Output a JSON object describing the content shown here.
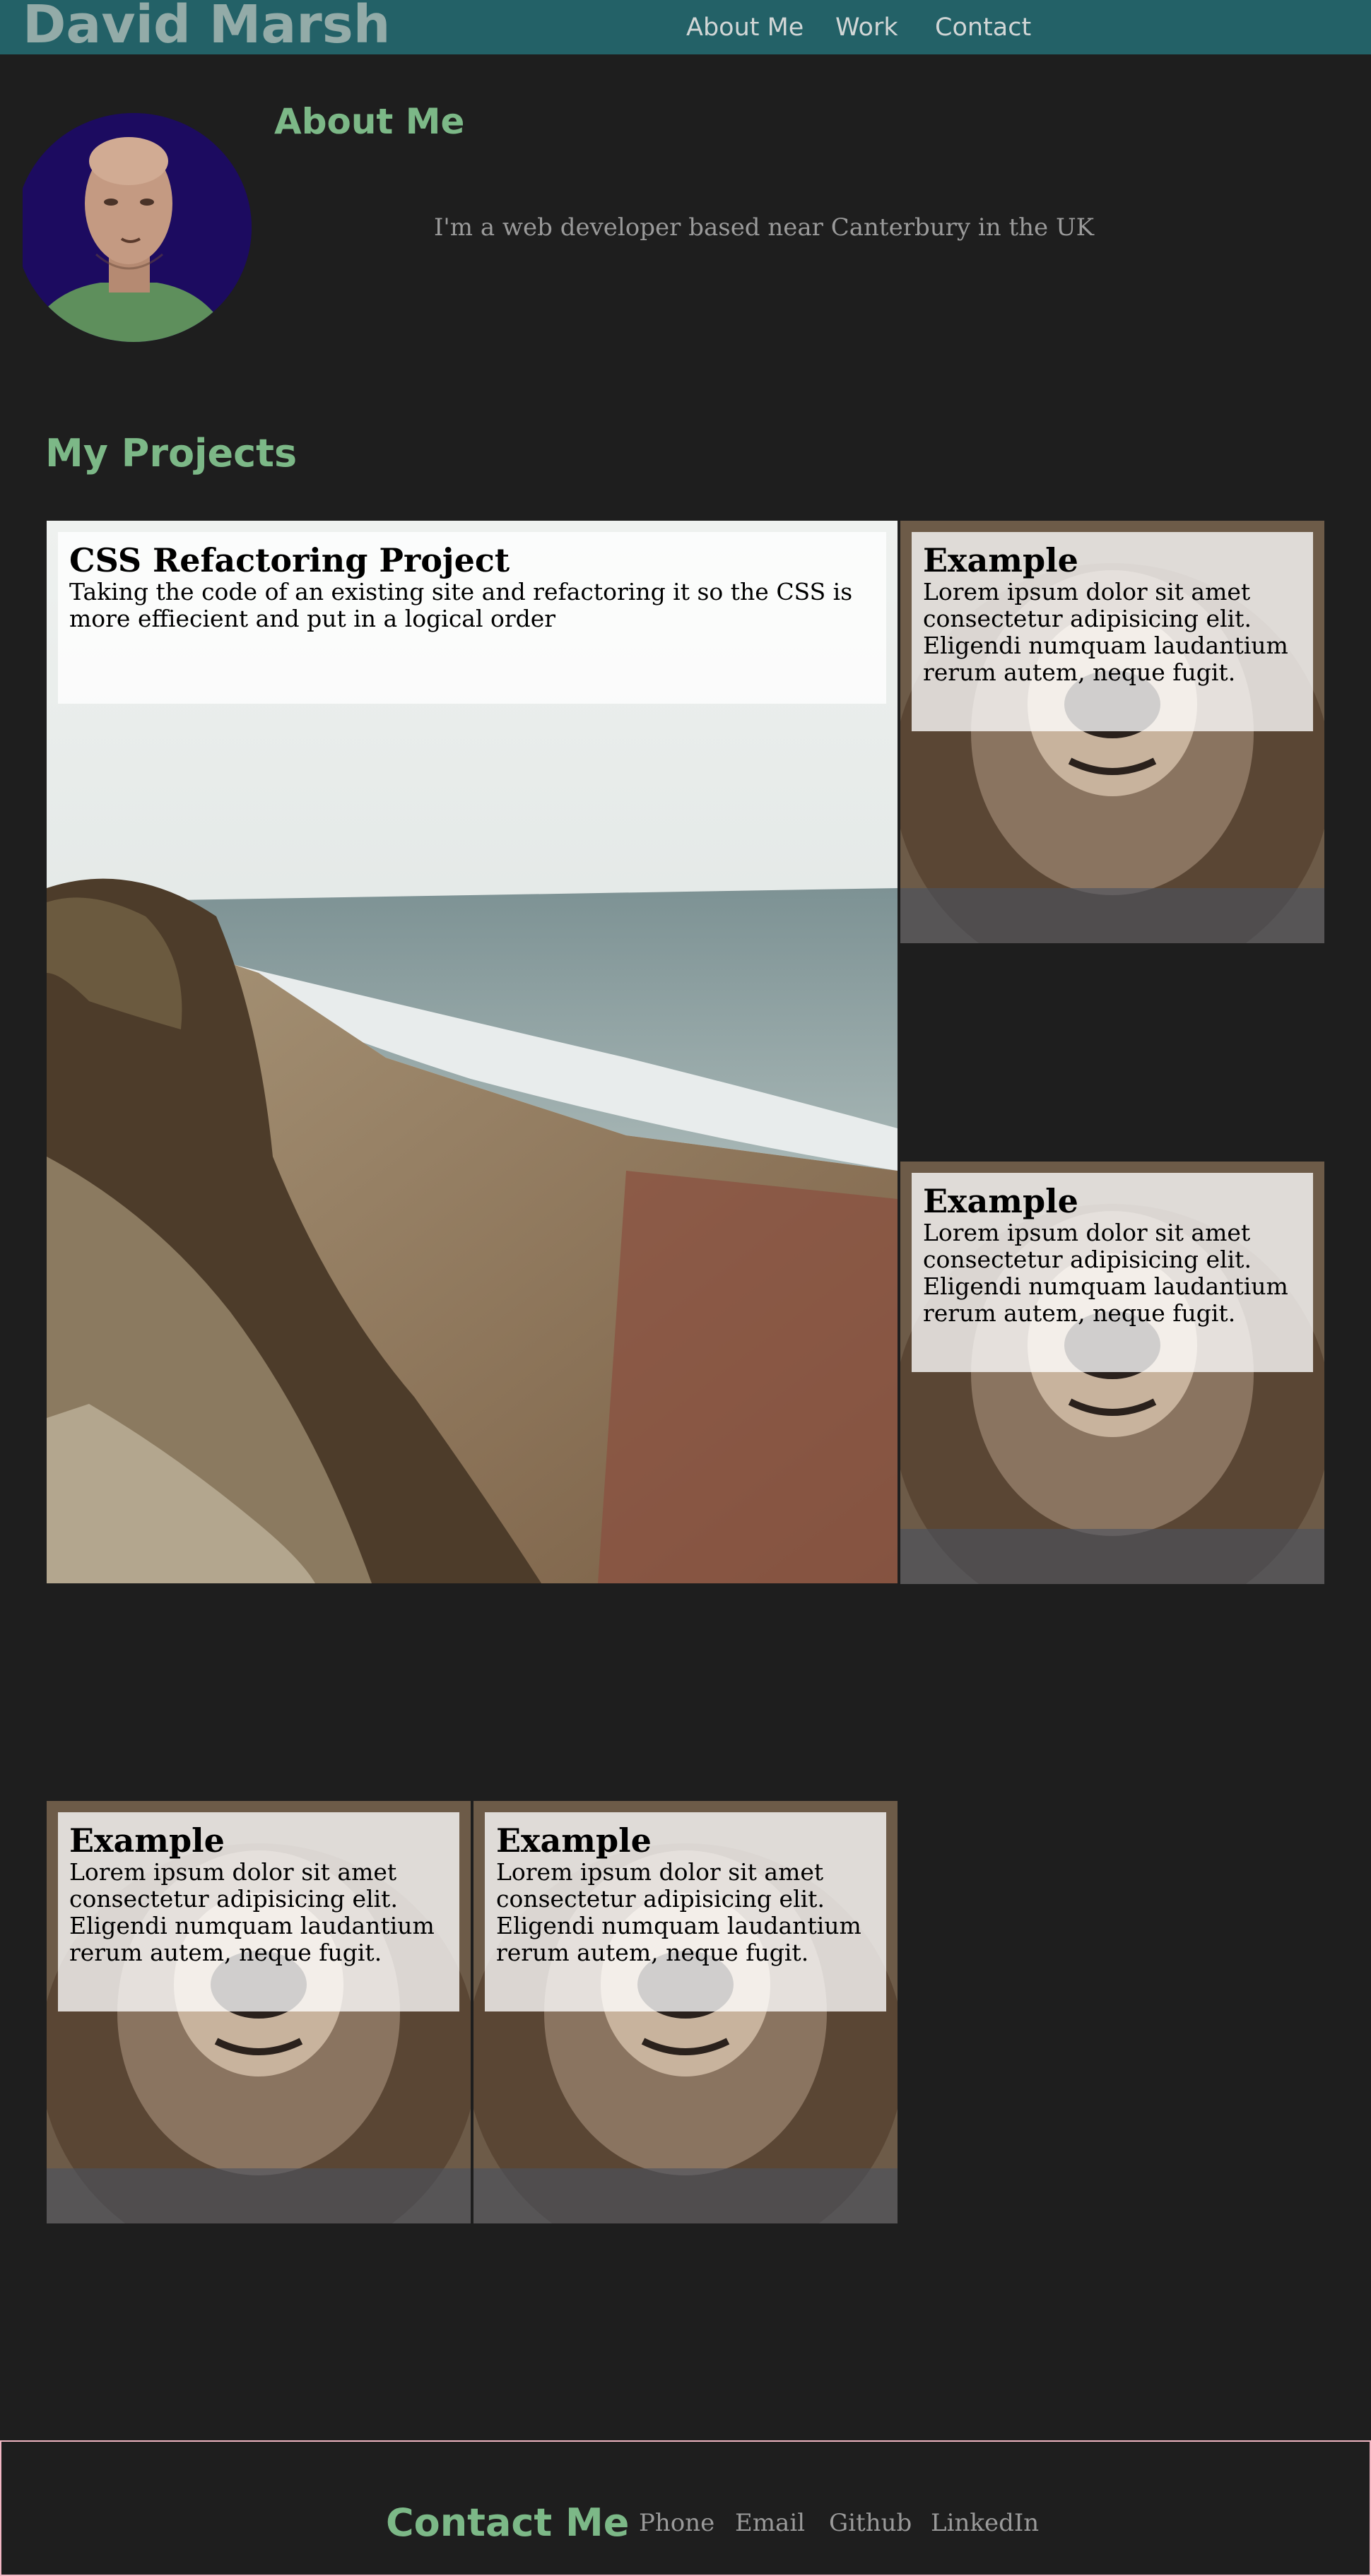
{
  "header": {
    "brand": "David Marsh",
    "nav": [
      {
        "label": "About Me"
      },
      {
        "label": "Work"
      },
      {
        "label": "Contact"
      }
    ]
  },
  "about": {
    "title": "About Me",
    "text": "I'm a web developer based near Canterbury in the UK"
  },
  "projects": {
    "title": "My Projects",
    "items": [
      {
        "title": "CSS Refactoring Project",
        "description": "Taking the code of an existing site and refactoring it so the CSS is more effiecient and put in a logical order",
        "image": "coastal-cliff-photo"
      },
      {
        "title": "Example",
        "description": "Lorem ipsum dolor sit amet consectetur adipisicing elit. Eligendi numquam laudantium rerum autem, neque fugit.",
        "image": "bear-photo"
      },
      {
        "title": "Example",
        "description": "Lorem ipsum dolor sit amet consectetur adipisicing elit. Eligendi numquam laudantium rerum autem, neque fugit.",
        "image": "bear-photo"
      },
      {
        "title": "Example",
        "description": "Lorem ipsum dolor sit amet consectetur adipisicing elit. Eligendi numquam laudantium rerum autem, neque fugit.",
        "image": "bear-photo"
      },
      {
        "title": "Example",
        "description": "Lorem ipsum dolor sit amet consectetur adipisicing elit. Eligendi numquam laudantium rerum autem, neque fugit.",
        "image": "bear-photo"
      }
    ]
  },
  "contact": {
    "title": "Contact Me",
    "links": [
      {
        "label": "Phone"
      },
      {
        "label": "Email"
      },
      {
        "label": "Github"
      },
      {
        "label": "LinkedIn"
      }
    ]
  },
  "colors": {
    "header_bg": "#236167",
    "page_bg": "#1e1e1e",
    "accent_green": "#7cb887",
    "footer_border": "#f1b6c3"
  }
}
